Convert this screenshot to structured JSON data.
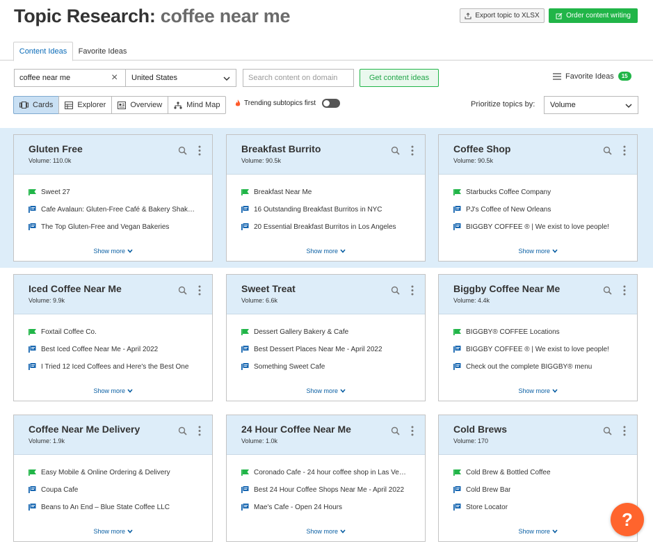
{
  "header": {
    "title_prefix": "Topic Research:",
    "title_query": "coffee near me",
    "export_label": "Export topic to XLSX",
    "order_label": "Order content writing"
  },
  "tabs": [
    {
      "label": "Content Ideas",
      "active": true
    },
    {
      "label": "Favorite Ideas",
      "active": false
    }
  ],
  "controls": {
    "query_value": "coffee near me",
    "country_value": "United States",
    "domain_placeholder": "Search content on domain",
    "get_button": "Get content ideas",
    "favorite_label": "Favorite Ideas",
    "favorite_count": "15"
  },
  "views": [
    {
      "label": "Cards",
      "icon": "cards-icon",
      "active": true
    },
    {
      "label": "Explorer",
      "icon": "table-icon",
      "active": false
    },
    {
      "label": "Overview",
      "icon": "overview-icon",
      "active": false
    },
    {
      "label": "Mind Map",
      "icon": "mindmap-icon",
      "active": false
    }
  ],
  "trending_label": "Trending subtopics first",
  "prioritize_label": "Prioritize topics by:",
  "prioritize_value": "Volume",
  "colors": {
    "green": "#21b548",
    "blue": "#0a6bb8",
    "band": "#ddedf9",
    "help": "#ff642d"
  },
  "cards": [
    {
      "title": "Gluten Free",
      "volume": "Volume:  110.0k",
      "items": [
        {
          "type": "trend",
          "text": "Sweet 27"
        },
        {
          "type": "question",
          "text": "Cafe Avalaun: Gluten-Free Café & Bakery Shak…"
        },
        {
          "type": "question",
          "text": "The Top Gluten-Free and Vegan Bakeries"
        }
      ]
    },
    {
      "title": "Breakfast Burrito",
      "volume": "Volume:  90.5k",
      "items": [
        {
          "type": "trend",
          "text": "Breakfast Near Me"
        },
        {
          "type": "question",
          "text": "16 Outstanding Breakfast Burritos in NYC"
        },
        {
          "type": "question",
          "text": "20 Essential Breakfast Burritos in Los Angeles"
        }
      ]
    },
    {
      "title": "Coffee Shop",
      "volume": "Volume:  90.5k",
      "items": [
        {
          "type": "trend",
          "text": "Starbucks Coffee Company"
        },
        {
          "type": "question",
          "text": "PJ's Coffee of New Orleans"
        },
        {
          "type": "question",
          "text": "BIGGBY COFFEE ® | We exist to love people!"
        }
      ]
    },
    {
      "title": "Iced Coffee Near Me",
      "volume": "Volume:  9.9k",
      "items": [
        {
          "type": "trend",
          "text": "Foxtail Coffee Co."
        },
        {
          "type": "question",
          "text": "Best Iced Coffee Near Me - April 2022"
        },
        {
          "type": "question",
          "text": "I Tried 12 Iced Coffees and Here's the Best One"
        }
      ]
    },
    {
      "title": "Sweet Treat",
      "volume": "Volume:  6.6k",
      "items": [
        {
          "type": "trend",
          "text": "Dessert Gallery Bakery & Cafe"
        },
        {
          "type": "question",
          "text": "Best Dessert Places Near Me - April 2022"
        },
        {
          "type": "question",
          "text": "Something Sweet Cafe"
        }
      ]
    },
    {
      "title": "Biggby Coffee Near Me",
      "volume": "Volume:  4.4k",
      "items": [
        {
          "type": "trend",
          "text": "BIGGBY® COFFEE Locations"
        },
        {
          "type": "question",
          "text": "BIGGBY COFFEE ® | We exist to love people!"
        },
        {
          "type": "question",
          "text": "Check out the complete BIGGBY® menu"
        }
      ]
    },
    {
      "title": "Coffee Near Me Delivery",
      "volume": "Volume:  1.9k",
      "items": [
        {
          "type": "trend",
          "text": "Easy Mobile & Online Ordering & Delivery"
        },
        {
          "type": "question",
          "text": "Coupa Cafe"
        },
        {
          "type": "question",
          "text": "Beans to An End – Blue State Coffee LLC"
        }
      ]
    },
    {
      "title": "24 Hour Coffee Near Me",
      "volume": "Volume:  1.0k",
      "items": [
        {
          "type": "trend",
          "text": "Coronado Cafe - 24 hour coffee shop in Las Ve…"
        },
        {
          "type": "question",
          "text": "Best 24 Hour Coffee Shops Near Me - April 2022"
        },
        {
          "type": "question",
          "text": "Mae's Cafe - Open 24 Hours"
        }
      ]
    },
    {
      "title": "Cold Brews",
      "volume": "Volume:  170",
      "items": [
        {
          "type": "trend",
          "text": "Cold Brew & Bottled Coffee"
        },
        {
          "type": "question",
          "text": "Cold Brew Bar"
        },
        {
          "type": "question",
          "text": "Store Locator"
        }
      ]
    }
  ],
  "show_more": "Show more",
  "help_label": "?"
}
